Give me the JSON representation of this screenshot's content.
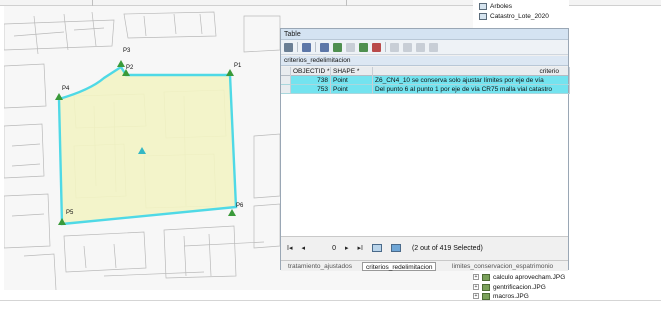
{
  "map": {
    "points": [
      {
        "name": "P1",
        "label": "P1"
      },
      {
        "name": "P2",
        "label": "P2"
      },
      {
        "name": "P3",
        "label": "P3"
      },
      {
        "name": "P4",
        "label": "P4"
      },
      {
        "name": "P5",
        "label": "P5"
      },
      {
        "name": "P6",
        "label": "P6"
      }
    ],
    "polygon_fill": "#f2f3c4",
    "polygon_stroke": "#4fd9e6",
    "marker_color": "#3a9a3a"
  },
  "toc": {
    "top_items": [
      {
        "label": "Arboles",
        "icon": "layer-icon"
      },
      {
        "label": "Catastro_Lote_2020",
        "icon": "layer-icon"
      }
    ],
    "bottom_items": [
      {
        "label": "calculo aprovecham.JPG",
        "icon": "image-icon"
      },
      {
        "label": "gentrificacion.JPG",
        "icon": "image-icon"
      },
      {
        "label": "macros.JPG",
        "icon": "image-icon"
      }
    ]
  },
  "table_window": {
    "title": "Table",
    "table_name": "criterios_redelimitacion",
    "columns": [
      "OBJECTID *",
      "SHAPE *",
      "criterio"
    ],
    "rows": [
      {
        "objectid": "738",
        "shape": "Point",
        "criterio": "Z6_CN4_10 se conserva solo ajustar límites por eje de vía"
      },
      {
        "objectid": "753",
        "shape": "Point",
        "criterio": "Del punto 6 al punto 1 por eje de vía CR75 malla vial catastro"
      }
    ],
    "nav_value": "0",
    "selection_text": "(2 out of 419 Selected)",
    "tabs": [
      {
        "label": "tratamiento_ajustados",
        "active": false
      },
      {
        "label": "criterios_redelimitacion",
        "active": true
      },
      {
        "label": "limites_conservacion_espatrimonio",
        "active": false
      }
    ],
    "selected_row_color": "#73e3ef"
  }
}
